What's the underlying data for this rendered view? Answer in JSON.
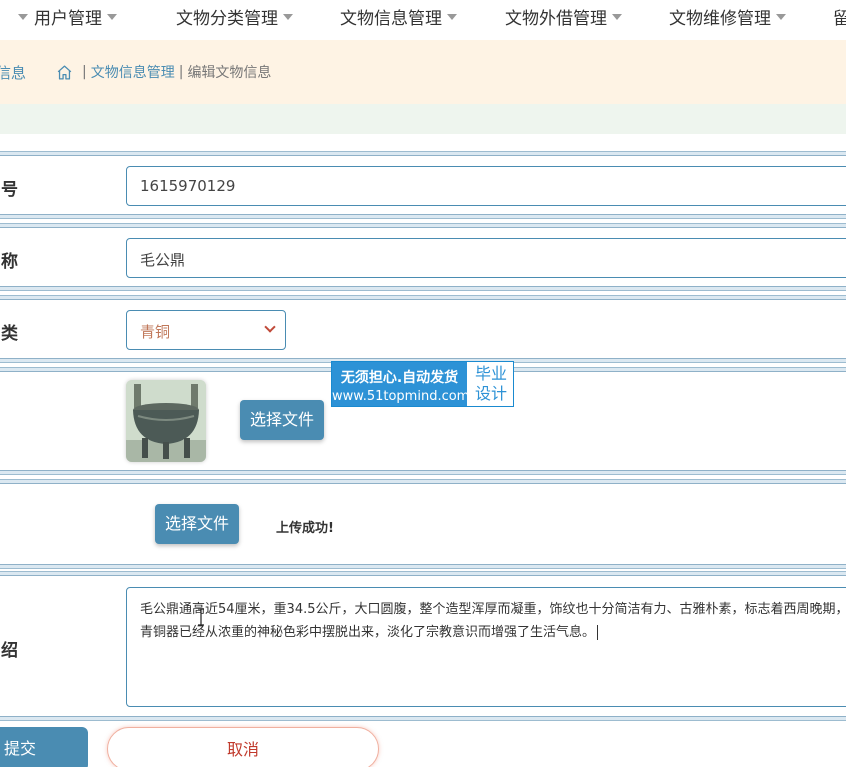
{
  "nav": {
    "items": [
      {
        "label": "用户管理"
      },
      {
        "label": "文物分类管理"
      },
      {
        "label": "文物信息管理"
      },
      {
        "label": "文物外借管理"
      },
      {
        "label": "文物维修管理"
      },
      {
        "label": "留"
      }
    ]
  },
  "breadcrumb": {
    "left_fragment": "信息",
    "parent": "文物信息管理",
    "current": "编辑文物信息",
    "separator": "|"
  },
  "form": {
    "number": {
      "label": "号",
      "value": "1615970129"
    },
    "name": {
      "label": "称",
      "value": "毛公鼎"
    },
    "category": {
      "label": "类",
      "value": "青铜"
    },
    "image": {
      "button": "选择文件"
    },
    "file": {
      "button": "选择文件",
      "status": "上传成功!"
    },
    "intro": {
      "label": "绍",
      "value": "毛公鼎通高近54厘米，重34.5公斤，大口圆腹，整个造型浑厚而凝重，饰纹也十分简洁有力、古雅朴素，标志着西周晚期，青铜器已经从浓重的神秘色彩中摆脱出来，淡化了宗教意识而增强了生活气息。"
    }
  },
  "watermark": {
    "line1": "无须担心.自动发货",
    "line2": "www.51topmind.com",
    "side1": "毕业",
    "side2": "设计"
  },
  "actions": {
    "submit": "提交",
    "cancel": "取消"
  },
  "colors": {
    "primary": "#4a8cb2",
    "crumb_bg": "#fef3e4",
    "cancel_text": "#c0392b"
  }
}
